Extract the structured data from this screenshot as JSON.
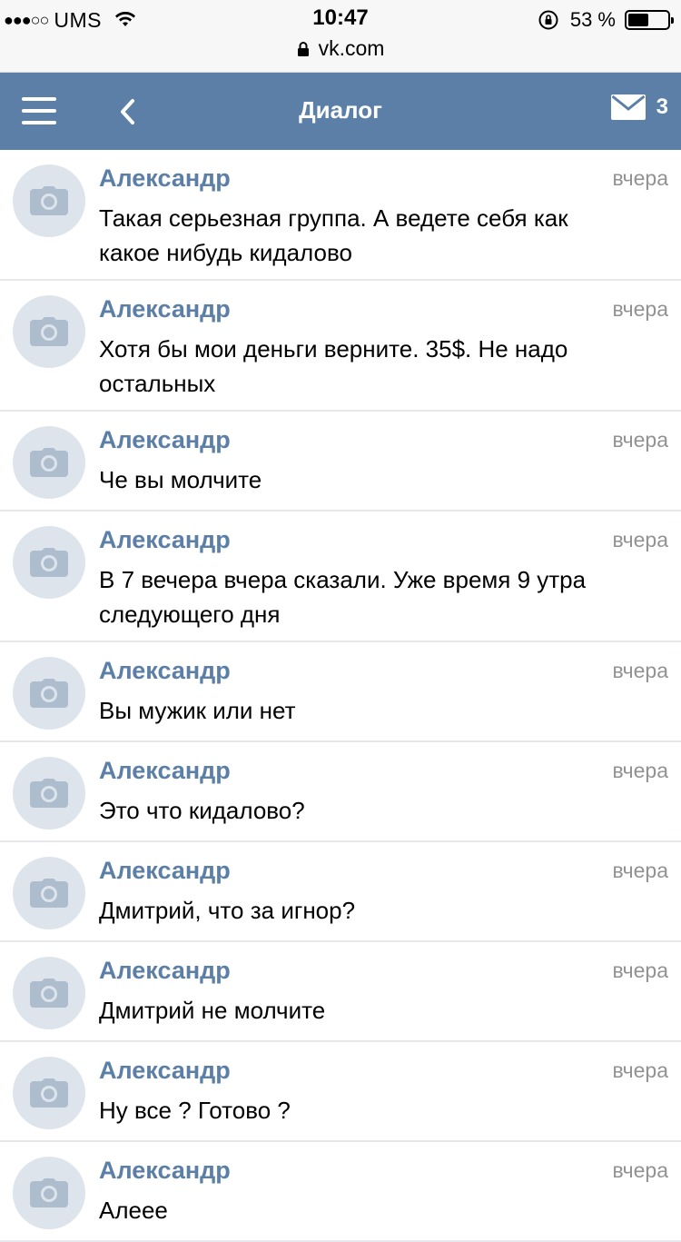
{
  "status_bar": {
    "carrier": "UMS",
    "time": "10:47",
    "battery": "53 %",
    "battery_level": 0.53
  },
  "browser": {
    "url": "vk.com"
  },
  "nav": {
    "title": "Диалог",
    "unread_count": "3"
  },
  "messages": [
    {
      "sender": "Александр",
      "time": "вчера",
      "text": "Такая серьезная группа. А ведете себя как какое нибудь кидалово"
    },
    {
      "sender": "Александр",
      "time": "вчера",
      "text": "Хотя бы мои деньги верните. 35$. Не надо остальных"
    },
    {
      "sender": "Александр",
      "time": "вчера",
      "text": "Че вы молчите"
    },
    {
      "sender": "Александр",
      "time": "вчера",
      "text": "В 7 вечера вчера сказали. Уже время 9 утра следующего дня"
    },
    {
      "sender": "Александр",
      "time": "вчера",
      "text": "Вы мужик или нет"
    },
    {
      "sender": "Александр",
      "time": "вчера",
      "text": "Это что кидалово?"
    },
    {
      "sender": "Александр",
      "time": "вчера",
      "text": "Дмитрий, что за игнор?"
    },
    {
      "sender": "Александр",
      "time": "вчера",
      "text": "Дмитрий не молчите"
    },
    {
      "sender": "Александр",
      "time": "вчера",
      "text": "Ну все ? Готово ?"
    },
    {
      "sender": "Александр",
      "time": "вчера",
      "text": "Алеее"
    }
  ],
  "colors": {
    "nav_bg": "#5b7fa6",
    "sender_name": "#5b7fa6",
    "avatar_bg": "#dde4ec",
    "avatar_icon": "#aebdcd",
    "timestamp": "#929292",
    "divider": "#e7e8ec"
  },
  "icons": {
    "menu": "menu-icon",
    "back": "chevron-left-icon",
    "mail": "mail-icon",
    "avatar": "camera-icon",
    "lock": "lock-icon",
    "wifi": "wifi-icon",
    "rotation_lock": "rotation-lock-icon"
  }
}
